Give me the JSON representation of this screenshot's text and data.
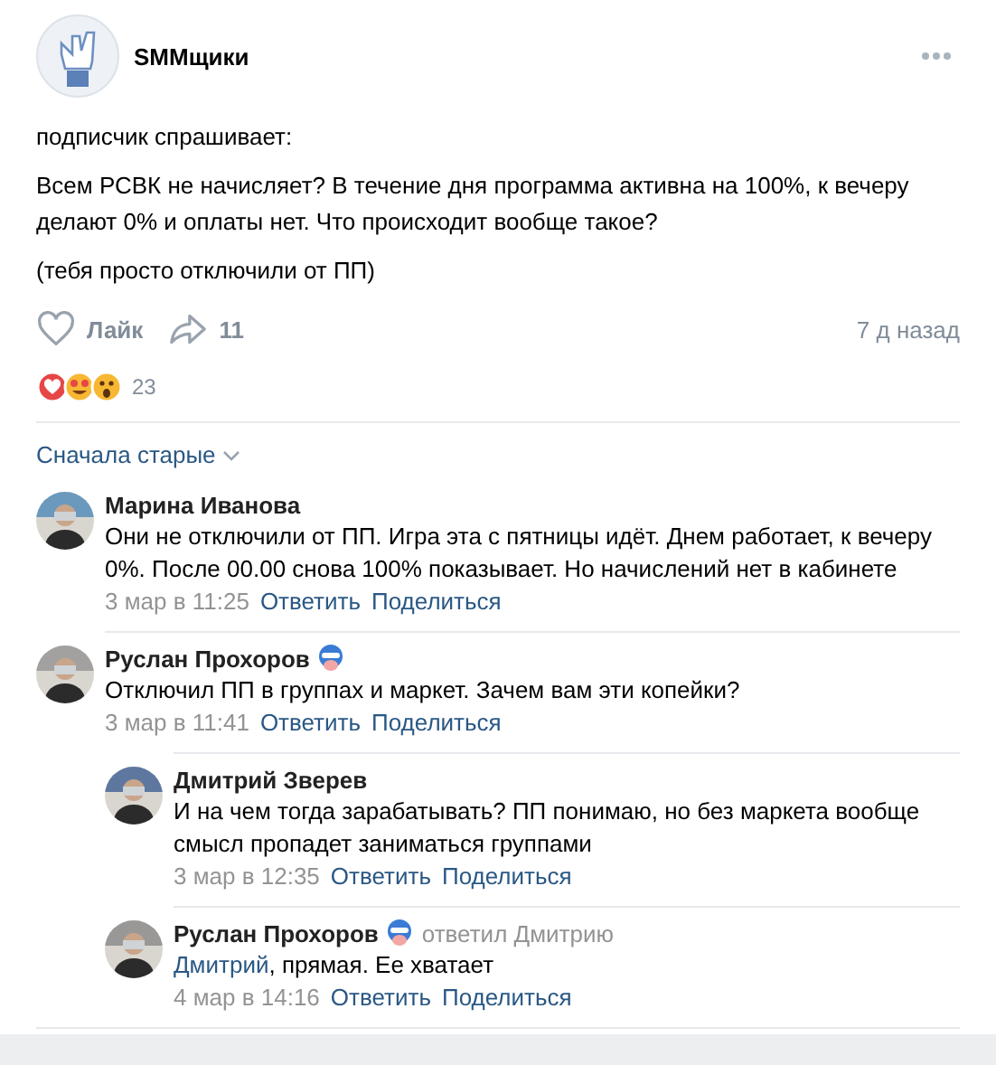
{
  "post": {
    "author": "SMMщики",
    "paragraphs": [
      "подписчик спрашивает:",
      "Всем РСВК не начисляет? В течение дня программа активна на 100%, к вечеру делают 0% и оплаты нет. Что происходит вообще такое?",
      "(тебя просто отключили от ПП)"
    ],
    "like_label": "Лайк",
    "liked": false,
    "share_count": "11",
    "time": "7 д назад",
    "reactions_count": "23"
  },
  "sort": {
    "label": "Сначала старые"
  },
  "comments": [
    {
      "author": "Марина Иванова",
      "badge": false,
      "text": "Они не отключили от ПП. Игра эта с пятницы идёт. Днем работает, к вечеру 0%. После 00.00 снова 100% показывает. Но начислений нет в кабинете",
      "date": "3 мар в 11:25",
      "reply": "Ответить",
      "share": "Поделиться"
    },
    {
      "author": "Руслан Прохоров",
      "badge": true,
      "text": "Отключил ПП в группах и маркет. Зачем вам эти копейки?",
      "date": "3 мар в 11:41",
      "reply": "Ответить",
      "share": "Поделиться",
      "children": [
        {
          "author": "Дмитрий Зверев",
          "badge": false,
          "text": "И на чем тогда зарабатывать? ПП понимаю, но без маркета вообще смысл пропадет заниматься группами",
          "date": "3 мар в 12:35",
          "reply": "Ответить",
          "share": "Поделиться"
        },
        {
          "author": "Руслан Прохоров",
          "badge": true,
          "replied_to": "ответил Дмитрию",
          "mention": "Дмитрий",
          "text": ", прямая. Ее хватает",
          "date": "4 мар в 14:16",
          "reply": "Ответить",
          "share": "Поделиться"
        }
      ]
    }
  ]
}
